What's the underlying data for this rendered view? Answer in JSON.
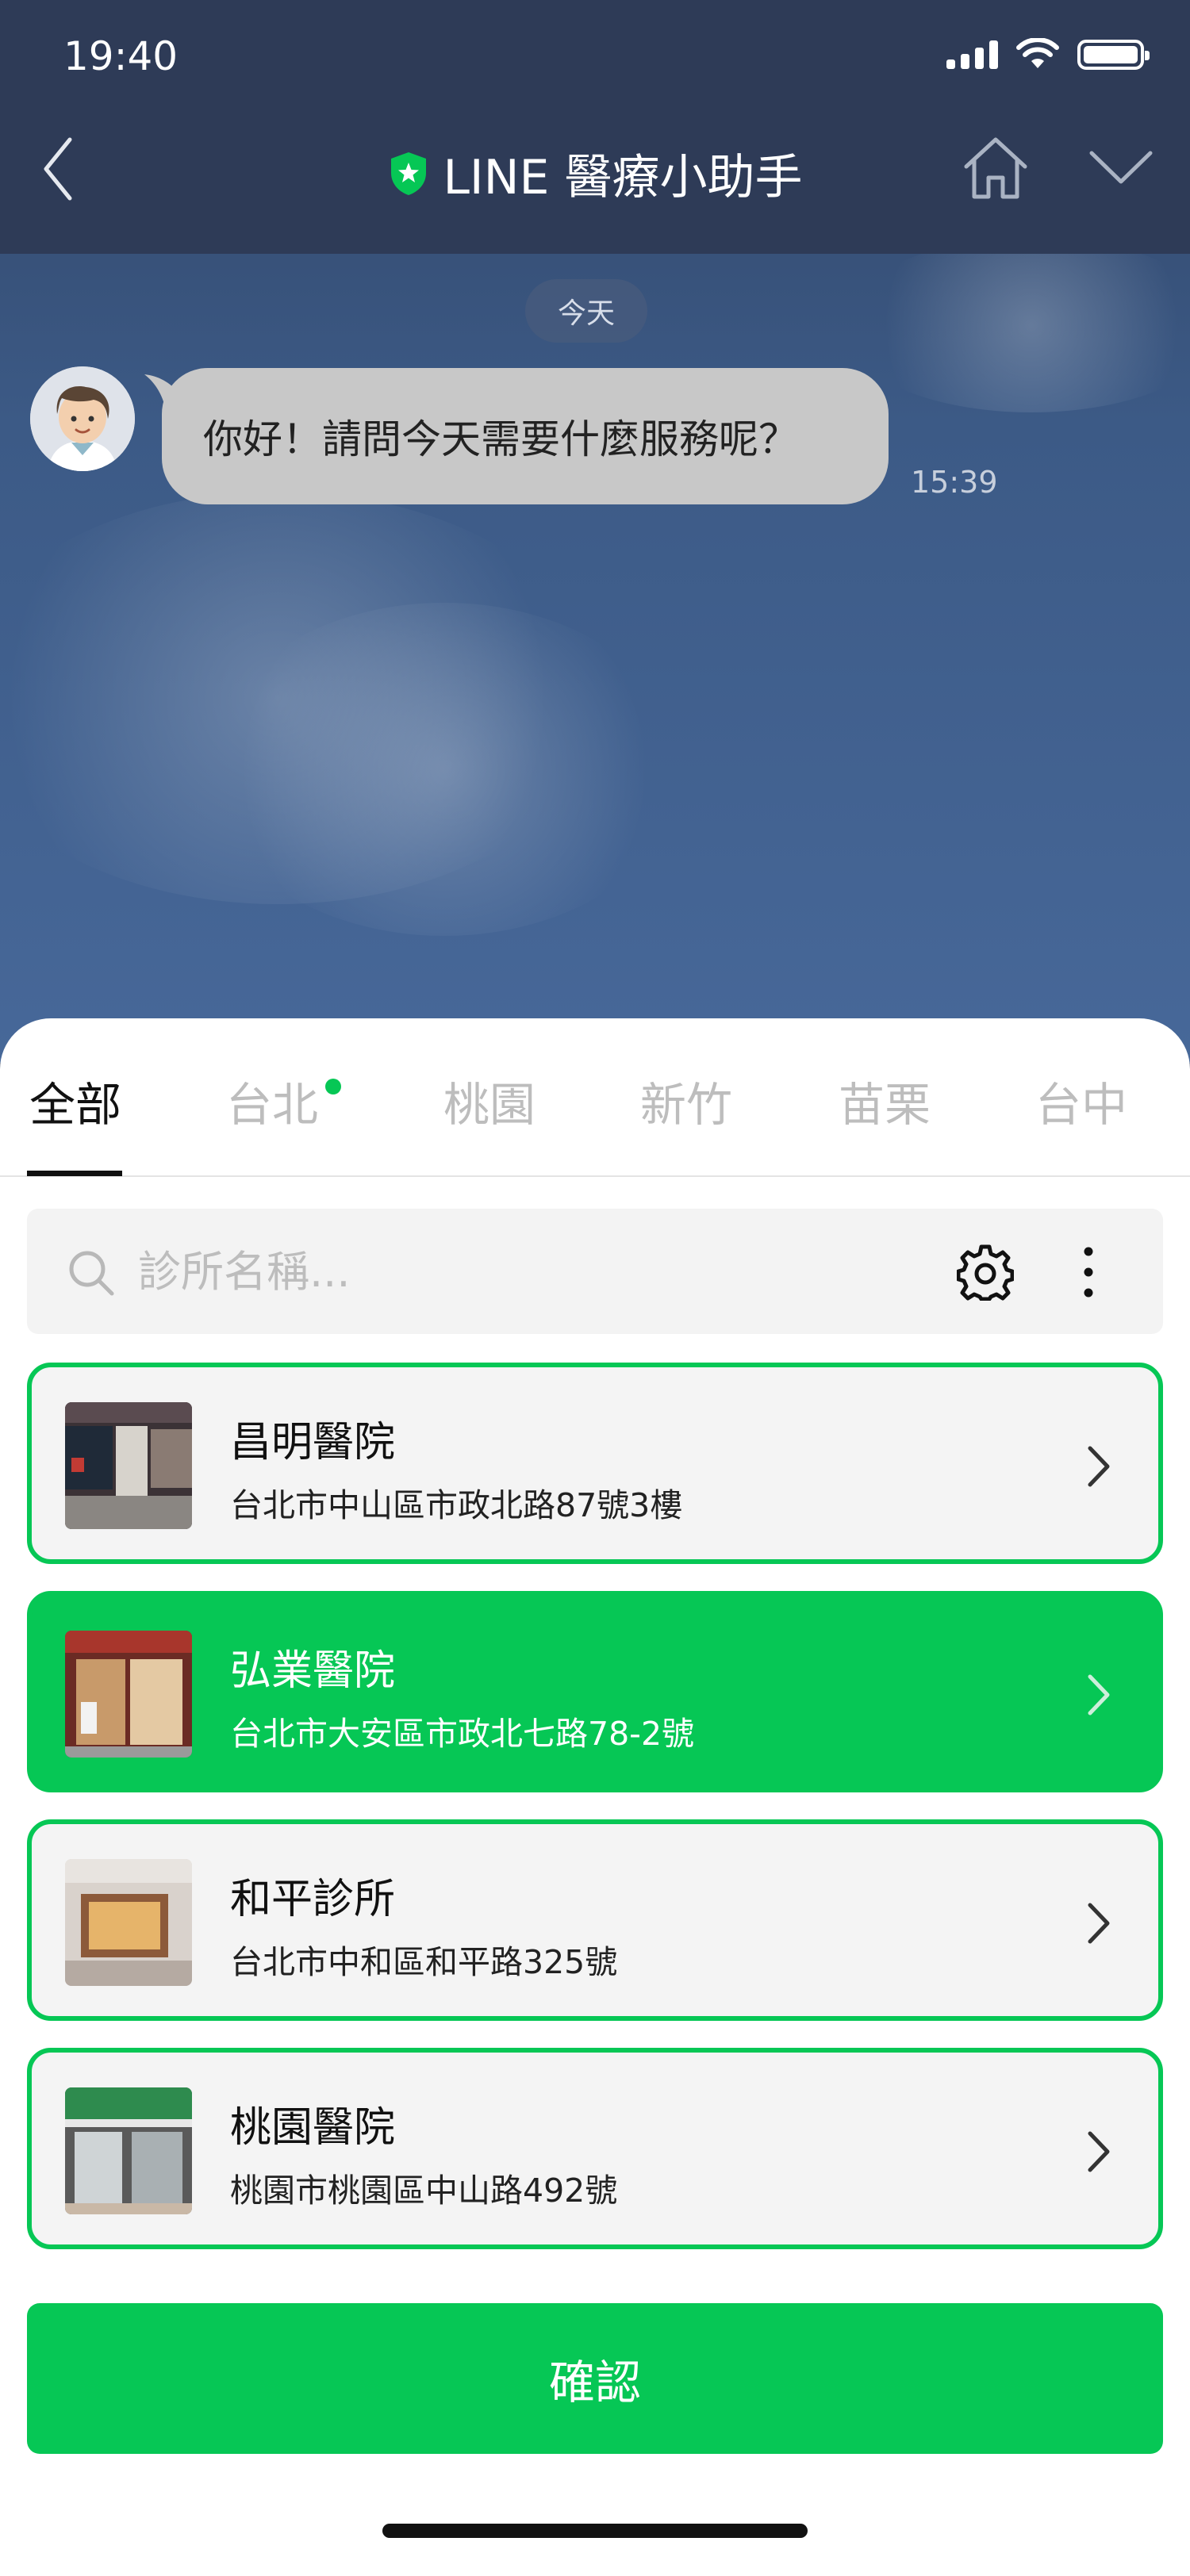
{
  "status_bar": {
    "time": "19:40"
  },
  "header": {
    "title": "LINE 醫療小助手"
  },
  "chat": {
    "date_label": "今天",
    "messages": [
      {
        "text": "你好！請問今天需要什麼服務呢？",
        "time": "15:39"
      }
    ]
  },
  "tabs": [
    {
      "label": "全部",
      "active": true
    },
    {
      "label": "台北",
      "active": false,
      "has_dot": true
    },
    {
      "label": "桃園",
      "active": false
    },
    {
      "label": "新竹",
      "active": false
    },
    {
      "label": "苗栗",
      "active": false
    },
    {
      "label": "台中",
      "active": false
    }
  ],
  "search": {
    "placeholder": "診所名稱..."
  },
  "clinics": [
    {
      "name": "昌明醫院",
      "address": "台北市中山區市政北路87號3樓",
      "selected": false
    },
    {
      "name": "弘業醫院",
      "address": "台北市大安區市政北七路78-2號",
      "selected": true
    },
    {
      "name": "和平診所",
      "address": "台北市中和區和平路325號",
      "selected": false
    },
    {
      "name": "桃園醫院",
      "address": "桃園市桃園區中山路492號",
      "selected": false
    }
  ],
  "confirm_label": "確認",
  "colors": {
    "accent": "#06c755",
    "header_bg": "#2e3b57",
    "card_bg": "#f4f4f4"
  }
}
